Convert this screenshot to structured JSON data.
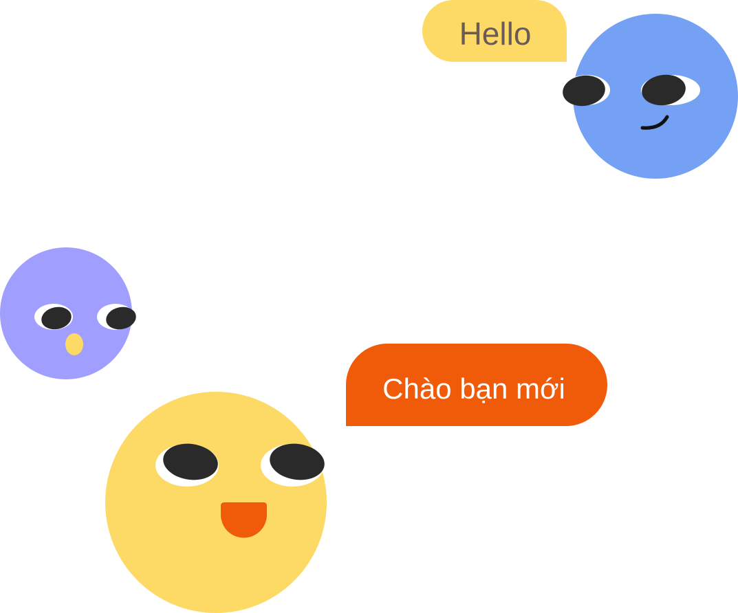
{
  "greetings": {
    "hello_text": "Hello",
    "welcome_text": "Chào bạn mới"
  },
  "colors": {
    "blue_face": "#74A1F4",
    "purple_face": "#A09EFF",
    "yellow_face": "#FDD966",
    "hello_bubble": "#FDD966",
    "hello_text": "#6B5B55",
    "welcome_bubble": "#F05B0A",
    "welcome_text": "#FFFFFF",
    "eye_dark": "#2A2A2A",
    "eye_white": "#FFFFFF",
    "mouth_orange": "#F05B0A"
  },
  "icons": {
    "blue_character": "smiling-face-icon",
    "purple_character": "surprised-face-icon",
    "yellow_character": "happy-face-icon"
  }
}
